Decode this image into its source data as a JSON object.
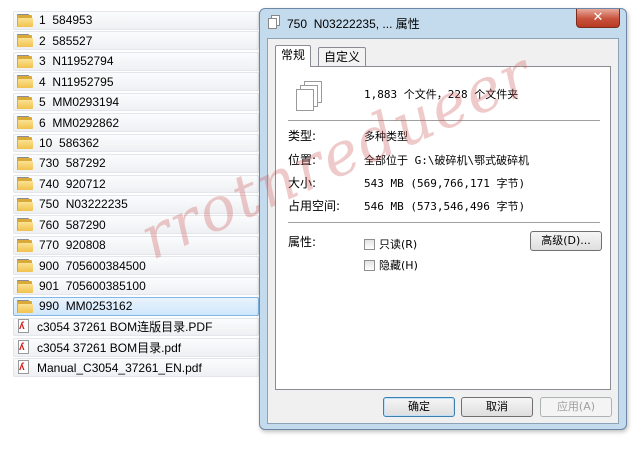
{
  "file_list": [
    {
      "type": "folder",
      "name": "1  584953"
    },
    {
      "type": "folder",
      "name": "2  585527"
    },
    {
      "type": "folder",
      "name": "3  N11952794"
    },
    {
      "type": "folder",
      "name": "4  N11952795"
    },
    {
      "type": "folder",
      "name": "5  MM0293194"
    },
    {
      "type": "folder",
      "name": "6  MM0292862"
    },
    {
      "type": "folder",
      "name": "10  586362"
    },
    {
      "type": "folder",
      "name": "730  587292"
    },
    {
      "type": "folder",
      "name": "740  920712"
    },
    {
      "type": "folder",
      "name": "750  N03222235"
    },
    {
      "type": "folder",
      "name": "760  587290"
    },
    {
      "type": "folder",
      "name": "770  920808"
    },
    {
      "type": "folder",
      "name": "900  705600384500"
    },
    {
      "type": "folder",
      "name": "901  705600385100"
    },
    {
      "type": "folder",
      "name": "990  MM0253162",
      "selected": true
    },
    {
      "type": "pdf",
      "name": "c3054 37261 BOM连版目录.PDF"
    },
    {
      "type": "pdf",
      "name": "c3054 37261 BOM目录.pdf"
    },
    {
      "type": "pdf",
      "name": "Manual_C3054_37261_EN.pdf"
    }
  ],
  "dialog": {
    "title": "750  N03222235, ... 属性",
    "close_label": "✕",
    "tabs": [
      {
        "label": "常规",
        "active": true
      },
      {
        "label": "自定义",
        "active": false
      }
    ],
    "summary": "1,883 个文件，228 个文件夹",
    "properties": [
      {
        "label": "类型:",
        "value": "多种类型"
      },
      {
        "label": "位置:",
        "value": "全部位于 G:\\破碎机\\鄂式破碎机"
      },
      {
        "label": "大小:",
        "value": "543 MB (569,766,171 字节)"
      },
      {
        "label": "占用空间:",
        "value": "546 MB (573,546,496 字节)"
      }
    ],
    "attributes_label": "属性:",
    "readonly_label": "只读(R)",
    "hidden_label": "隐藏(H)",
    "advanced_label": "高级(D)...",
    "ok_label": "确定",
    "cancel_label": "取消",
    "apply_label": "应用(A)"
  },
  "watermark": "rrotnredueer"
}
